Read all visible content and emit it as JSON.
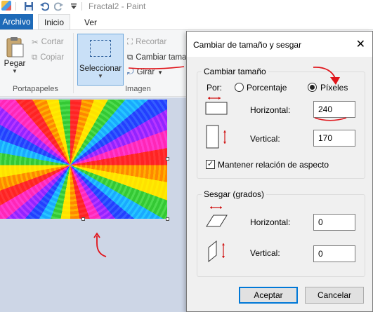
{
  "window": {
    "title": "Fractal2 - Paint"
  },
  "tabs": {
    "file": "Archivo",
    "home": "Inicio",
    "view": "Ver"
  },
  "ribbon": {
    "clipboard": {
      "paste": "Pegar",
      "cut": "Cortar",
      "copy": "Copiar",
      "group_label": "Portapapeles"
    },
    "image": {
      "select": "Seleccionar",
      "crop": "Recortar",
      "resize": "Cambiar tama",
      "rotate": "Girar",
      "group_label": "Imagen"
    }
  },
  "dialog": {
    "title": "Cambiar de tamaño y sesgar",
    "close": "✕",
    "resize": {
      "legend": "Cambiar tamaño",
      "by_label": "Por:",
      "percent_label": "Porcentaje",
      "pixels_label": "Píxeles",
      "selected_unit": "pixels",
      "horizontal_label": "Horizontal:",
      "horizontal_value": "240",
      "vertical_label": "Vertical:",
      "vertical_value": "170",
      "keep_aspect_label": "Mantener relación de aspecto",
      "keep_aspect_checked": true
    },
    "skew": {
      "legend": "Sesgar (grados)",
      "horizontal_label": "Horizontal:",
      "horizontal_value": "0",
      "vertical_label": "Vertical:",
      "vertical_value": "0"
    },
    "ok": "Aceptar",
    "cancel": "Cancelar"
  },
  "colors": {
    "accent": "#1e6ab8",
    "annotation": "#e0151b",
    "workspace": "#cdd6e6"
  }
}
